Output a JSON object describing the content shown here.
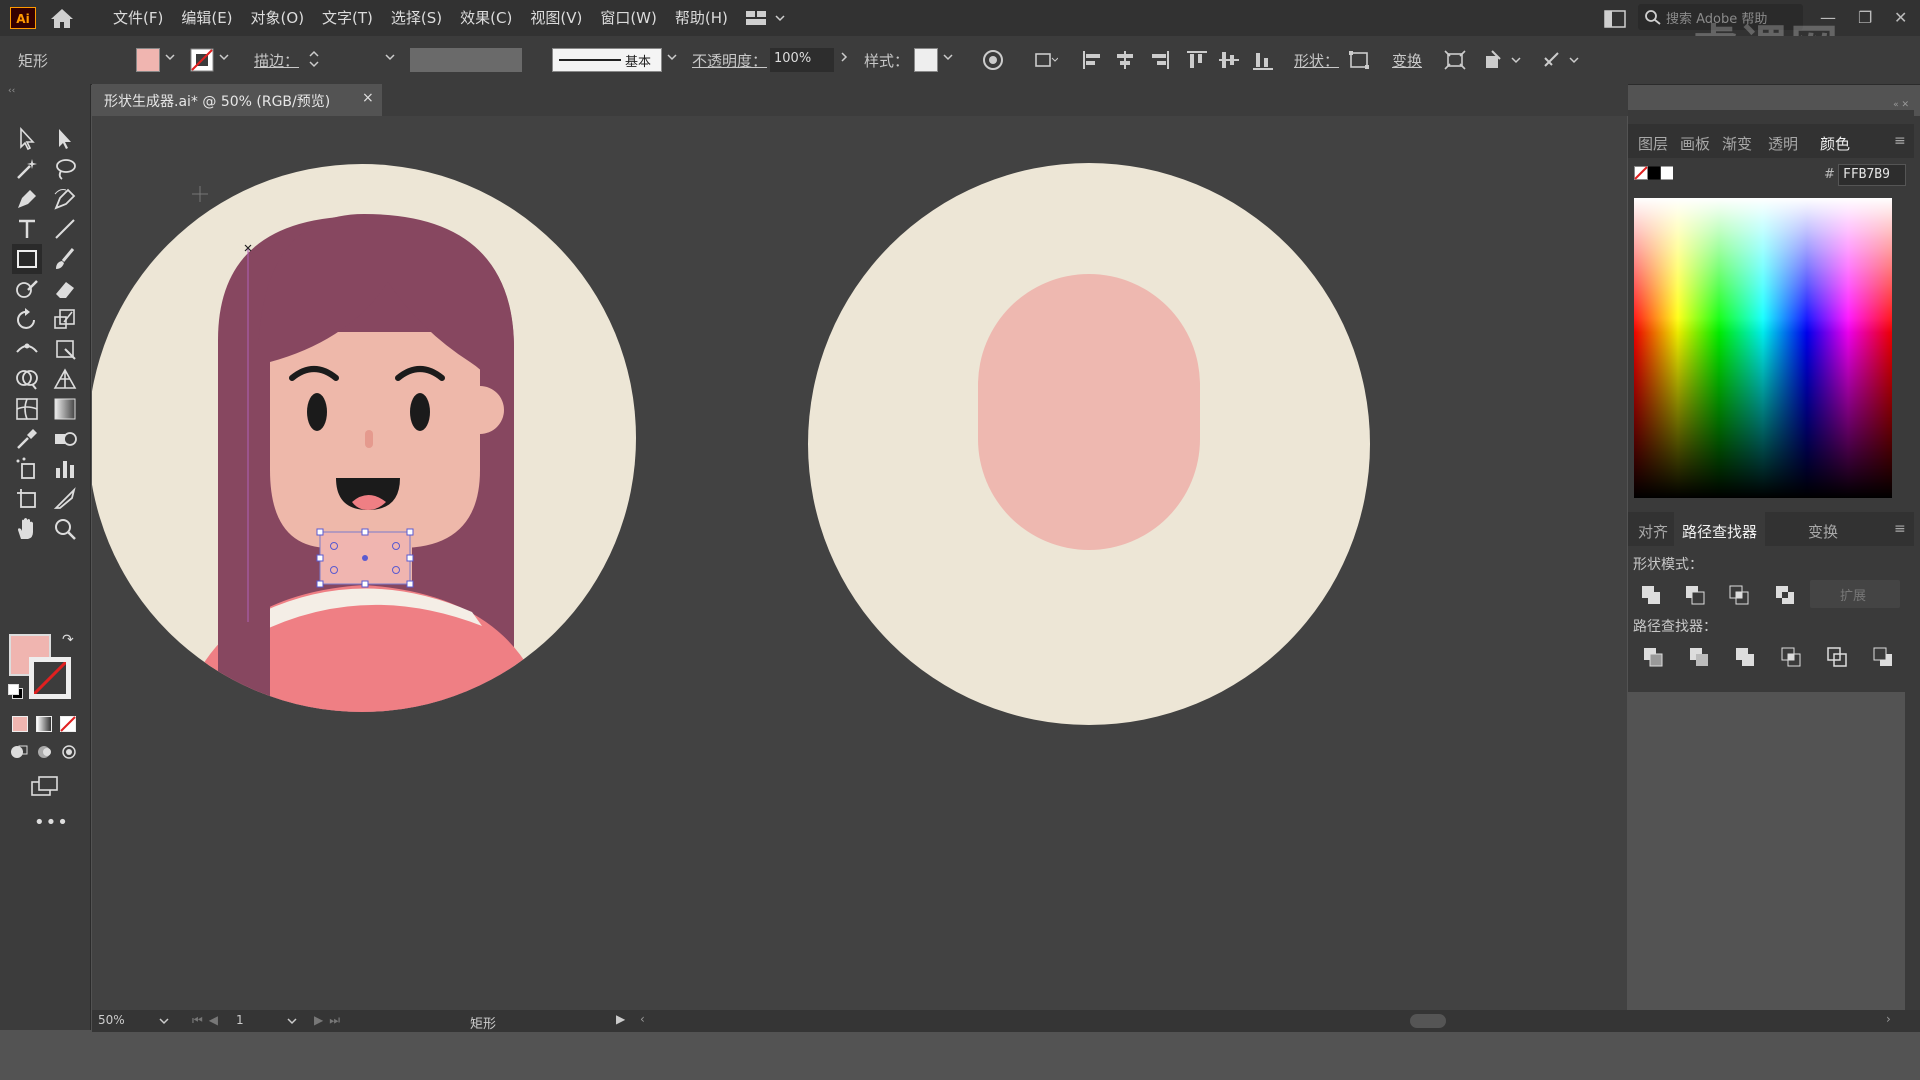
{
  "app": {
    "logo": "Ai"
  },
  "menu": [
    "文件(F)",
    "编辑(E)",
    "对象(O)",
    "文字(T)",
    "选择(S)",
    "效果(C)",
    "视图(V)",
    "窗口(W)",
    "帮助(H)"
  ],
  "search": {
    "placeholder": "搜索 Adobe 帮助"
  },
  "watermark": "虎课网",
  "control_bar": {
    "object_type": "矩形",
    "stroke_label": "描边：",
    "stroke_style": "基本",
    "opacity_label": "不透明度：",
    "opacity_value": "100%",
    "style_label": "样式：",
    "shape_label": "形状：",
    "transform_label": "变换",
    "fill_color": "#f0b5b0"
  },
  "document": {
    "tab_title": "形状生成器.ai* @ 50% (RGB/预览)",
    "close": "×"
  },
  "canvas": {
    "background_color": "#424242",
    "artboard_bg_color": "#ede6d6",
    "hair_color": "#874760",
    "skin_color": "#eeb8aa",
    "shirt_color": "#ef7f84",
    "stripe_color": "#f4eee6"
  },
  "color_panel": {
    "tabs": [
      "图层",
      "画板",
      "渐变",
      "透明",
      "颜色"
    ],
    "active_tab": "颜色",
    "hex_prefix": "#",
    "hex_value": "FFB7B9"
  },
  "pathfinder_panel": {
    "tabs": [
      "对齐",
      "路径查找器",
      "变换"
    ],
    "active_tab": "路径查找器",
    "shape_modes_label": "形状模式：",
    "expand_label": "扩展",
    "pathfinders_label": "路径查找器："
  },
  "status_bar": {
    "zoom": "50%",
    "artboard": "1",
    "tool": "矩形"
  }
}
